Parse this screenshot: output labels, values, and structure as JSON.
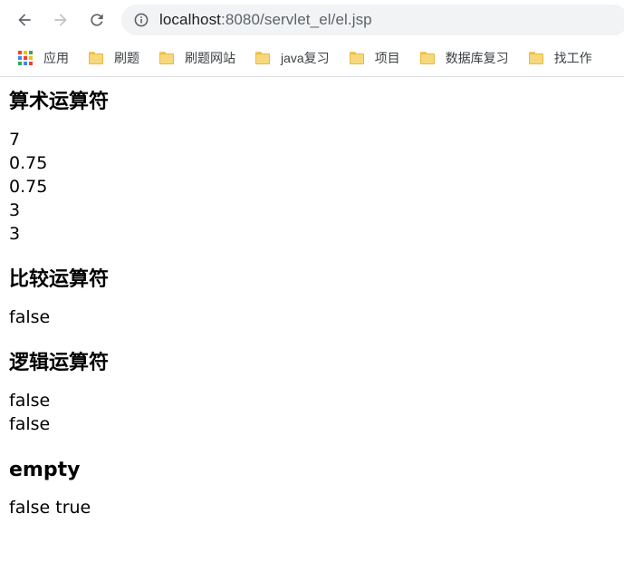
{
  "browser": {
    "url_host": "localhost",
    "url_rest": ":8080/servlet_el/el.jsp",
    "bookmarks": [
      {
        "label": "应用",
        "icon": "apps-icon"
      },
      {
        "label": "刷题",
        "icon": "folder-icon"
      },
      {
        "label": "刷题网站",
        "icon": "folder-icon"
      },
      {
        "label": "java复习",
        "icon": "folder-icon"
      },
      {
        "label": "项目",
        "icon": "folder-icon"
      },
      {
        "label": "数据库复习",
        "icon": "folder-icon"
      },
      {
        "label": "找工作",
        "icon": "folder-icon"
      }
    ]
  },
  "page": {
    "sections": [
      {
        "heading": "算术运算符",
        "lines": [
          "7",
          "0.75",
          "0.75",
          "3",
          "3"
        ]
      },
      {
        "heading": "比较运算符",
        "lines": [
          "false"
        ]
      },
      {
        "heading": "逻辑运算符",
        "lines": [
          "false",
          "false"
        ]
      },
      {
        "heading": "empty",
        "lines": [
          "false true"
        ]
      }
    ]
  },
  "colors": {
    "omnibox_bg": "#f1f3f4",
    "folder": "#f6d87a",
    "icon_gray": "#5f6368",
    "icon_disabled": "#bdc1c6"
  }
}
